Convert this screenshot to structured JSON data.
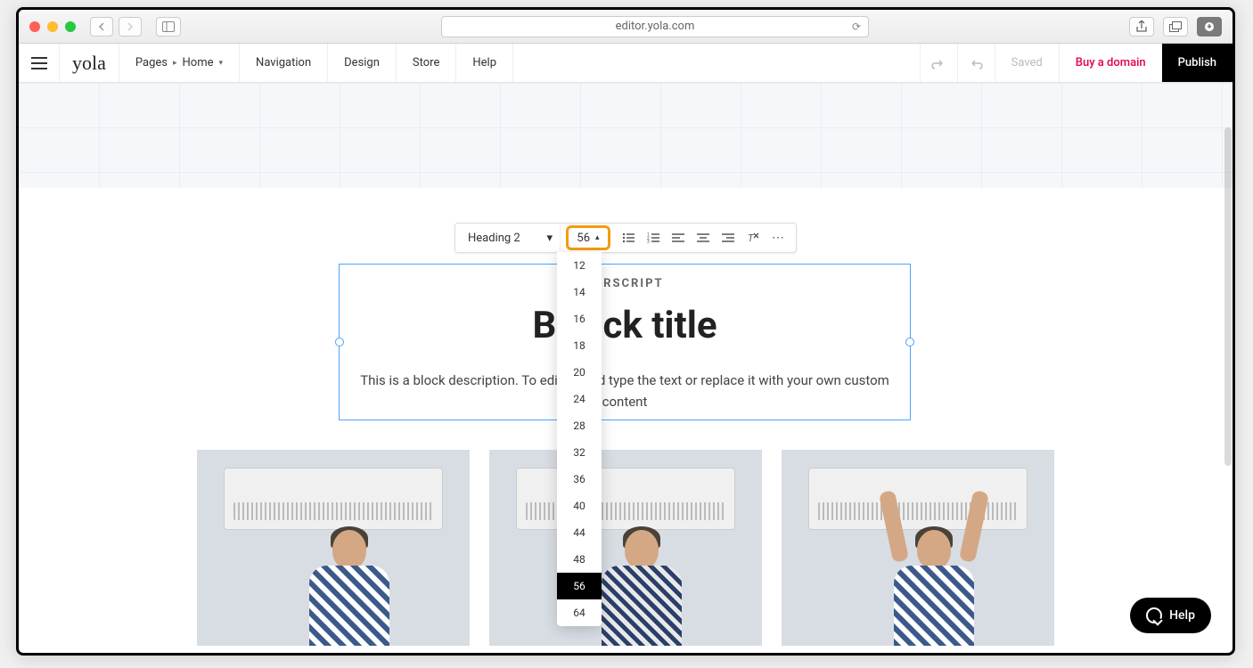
{
  "browser": {
    "url": "editor.yola.com",
    "traffic_colors": [
      "#ff5f57",
      "#febc2e",
      "#28c840"
    ]
  },
  "appbar": {
    "logo_text": "yola",
    "pages_label": "Pages",
    "pages_current": "Home",
    "menu": [
      "Navigation",
      "Design",
      "Store",
      "Help"
    ],
    "saved_label": "Saved",
    "buy_label": "Buy a domain",
    "publish_label": "Publish"
  },
  "text_toolbar": {
    "style_select": "Heading 2",
    "font_size_current": "56",
    "font_size_options": [
      "12",
      "14",
      "16",
      "18",
      "20",
      "24",
      "28",
      "32",
      "36",
      "40",
      "44",
      "48",
      "56",
      "64"
    ],
    "font_size_selected": "56"
  },
  "block": {
    "superscript": "PERSCRIPT",
    "title_left": "B",
    "title_right": "ck title",
    "desc_left": "This is a block description. To edit,",
    "desc_right": "d type the text or replace it with your own custom",
    "desc_line2": "content"
  },
  "help_label": "Help"
}
